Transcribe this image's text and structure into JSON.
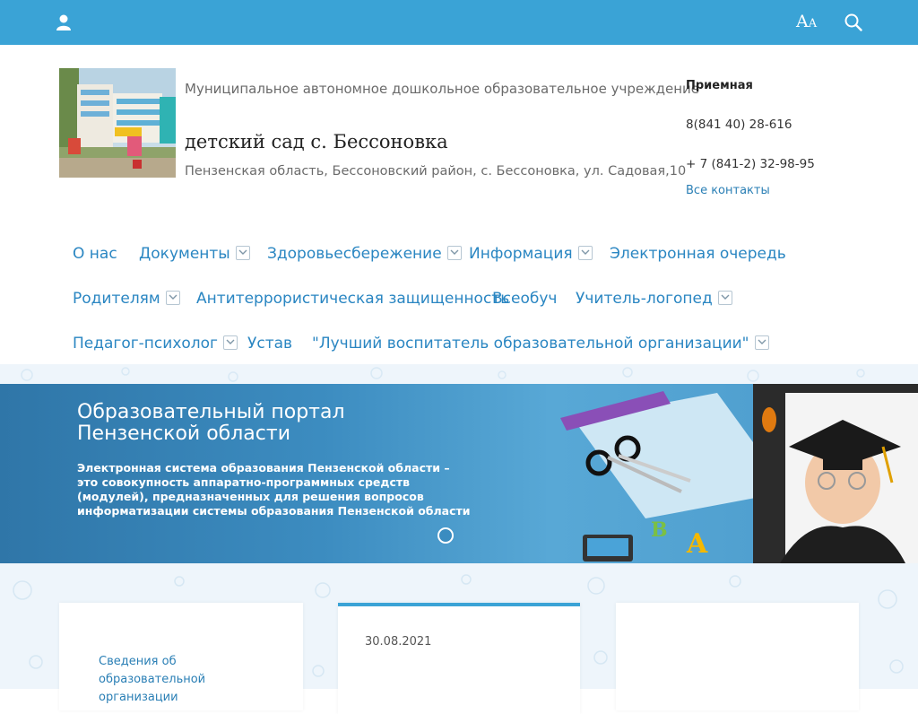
{
  "topbar": {
    "font_size_big": "A",
    "font_size_small": "A",
    "icons": [
      "user-icon",
      "font-size-icon",
      "search-icon"
    ],
    "color": "#3aa3d6"
  },
  "header": {
    "org_type": "Муниципальное автономное дошкольное образовательное учреждение",
    "org_name": "детский сад с. Бессоновка",
    "org_address": "Пензенская область, Бессоновский район, с. Бессоновка, ул. Садовая,10",
    "contacts_title": "Приемная",
    "phone_1": "8(841 40) 28-616",
    "phone_2": "+ 7 (841-2) 32-98-95",
    "all_contacts": "Все контакты"
  },
  "nav": {
    "items": [
      {
        "label": "О нас"
      },
      {
        "label": "Документы"
      },
      {
        "label": "Здоровьесбережение"
      },
      {
        "label": "Информация"
      },
      {
        "label": "Электронная очередь"
      },
      {
        "label": "Родителям"
      },
      {
        "label": "Антитеррористическая защищенность"
      },
      {
        "label": "Всеобуч"
      },
      {
        "label": "Учитель-логопед"
      },
      {
        "label": "Педагог-психолог"
      },
      {
        "label": "Устав"
      },
      {
        "label": "\"Лучший воспитатель образовательной организации\""
      }
    ]
  },
  "banner": {
    "title": "Образовательный портал Пензенской области",
    "text": "Электронная система образования Пензенской области – это совокупность аппаратно-программных средств (модулей), предназначенных для решения вопросов информатизации системы образования Пензенской области"
  },
  "cards": {
    "card1_link": "Сведения об образовательной организации",
    "card2_date": "30.08.2021"
  },
  "colors": {
    "accent": "#3aa3d6",
    "link": "#2a86c2"
  }
}
